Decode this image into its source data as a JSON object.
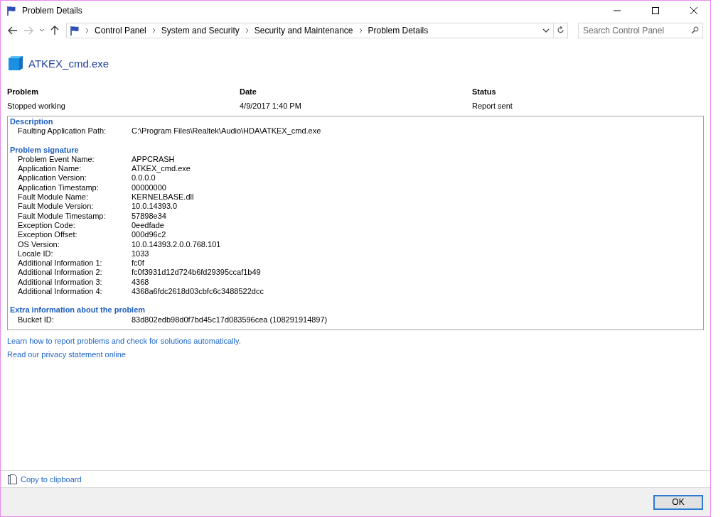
{
  "window": {
    "title": "Problem Details"
  },
  "address_bar": {
    "breadcrumbs": [
      "Control Panel",
      "System and Security",
      "Security and Maintenance",
      "Problem Details"
    ]
  },
  "search": {
    "placeholder": "Search Control Panel"
  },
  "app_name": "ATKEX_cmd.exe",
  "summary": [
    {
      "heading": "Problem",
      "value": "Stopped working"
    },
    {
      "heading": "Date",
      "value": "4/9/2017 1:40 PM"
    },
    {
      "heading": "Status",
      "value": "Report sent"
    }
  ],
  "details": [
    {
      "title": "Description",
      "rows": [
        {
          "label": "Faulting Application Path:",
          "value": "C:\\Program Files\\Realtek\\Audio\\HDA\\ATKEX_cmd.exe"
        }
      ]
    },
    {
      "title": "Problem signature",
      "rows": [
        {
          "label": "Problem Event Name:",
          "value": "APPCRASH"
        },
        {
          "label": "Application Name:",
          "value": "ATKEX_cmd.exe"
        },
        {
          "label": "Application Version:",
          "value": "0.0.0.0"
        },
        {
          "label": "Application Timestamp:",
          "value": "00000000"
        },
        {
          "label": "Fault Module Name:",
          "value": "KERNELBASE.dll"
        },
        {
          "label": "Fault Module Version:",
          "value": "10.0.14393.0"
        },
        {
          "label": "Fault Module Timestamp:",
          "value": "57898e34"
        },
        {
          "label": "Exception Code:",
          "value": "0eedfade"
        },
        {
          "label": "Exception Offset:",
          "value": "000d96c2"
        },
        {
          "label": "OS Version:",
          "value": "10.0.14393.2.0.0.768.101"
        },
        {
          "label": "Locale ID:",
          "value": "1033"
        },
        {
          "label": "Additional Information 1:",
          "value": "fc0f"
        },
        {
          "label": "Additional Information 2:",
          "value": "fc0f3931d12d724b6fd29395ccaf1b49"
        },
        {
          "label": "Additional Information 3:",
          "value": "4368"
        },
        {
          "label": "Additional Information 4:",
          "value": "4368a6fdc2618d03cbfc6c3488522dcc"
        }
      ]
    },
    {
      "title": "Extra information about the problem",
      "rows": [
        {
          "label": "Bucket ID:",
          "value": "83d802edb98d0f7bd45c17d083596cea (108291914897)"
        }
      ]
    }
  ],
  "links": [
    "Learn how to report problems and check for solutions automatically.",
    "Read our privacy statement online"
  ],
  "copy_link": "Copy to clipboard",
  "buttons": [
    "OK"
  ]
}
